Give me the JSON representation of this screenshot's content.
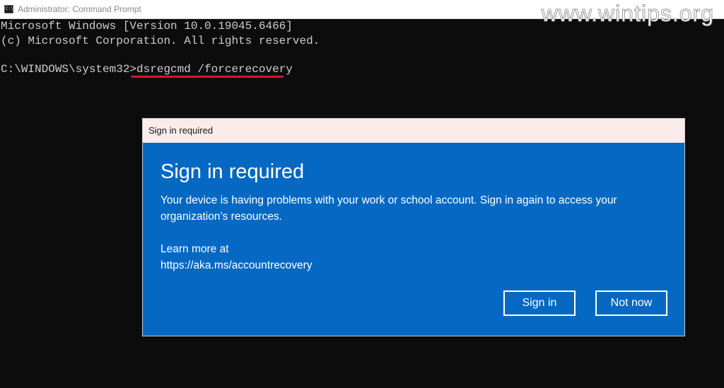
{
  "window": {
    "title": "Administrator: Command Prompt",
    "icon": "cmd-icon",
    "icon_glyph": "C:\\",
    "watermark": "www.wintips.org"
  },
  "console": {
    "line1": "Microsoft Windows [Version 10.0.19045.6466]",
    "line2": "(c) Microsoft Corporation. All rights reserved.",
    "prompt": "C:\\WINDOWS\\system32>",
    "command": "dsregcmd /forcerecovery",
    "highlight_color": "#d5172c"
  },
  "dialog": {
    "titlebar": "Sign in required",
    "heading": "Sign in required",
    "message": "Your device is having problems with your work or school account. Sign in again to access your organization’s resources.",
    "learn_more_label": "Learn more at",
    "learn_more_url": "https://aka.ms/accountrecovery",
    "sign_in_label": "Sign in",
    "not_now_label": "Not now",
    "accent_color": "#0569c3"
  }
}
